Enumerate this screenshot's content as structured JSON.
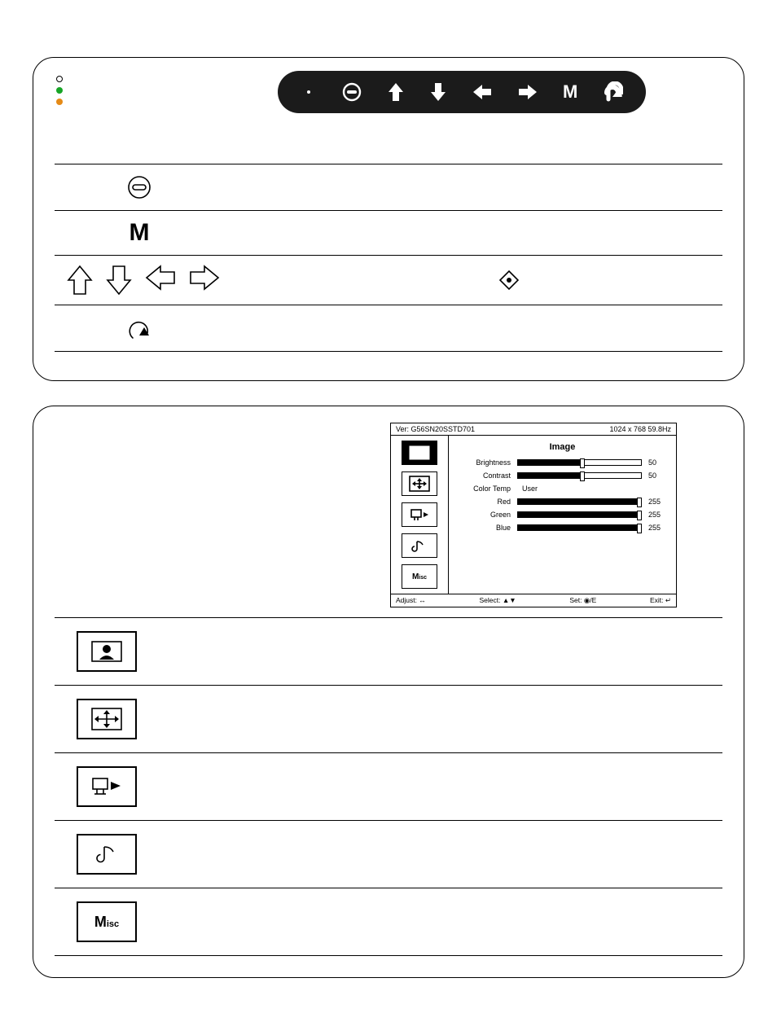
{
  "panel1": {
    "buttons": [
      "power",
      "menu-up",
      "menu-down",
      "menu-left",
      "menu-right",
      "menu-m",
      "return"
    ]
  },
  "osd": {
    "version_label": "Ver: G56SN20SSTD701",
    "mode_label": "1024 x 768  59.8Hz",
    "tabs": [
      "image",
      "position",
      "setup",
      "audio",
      "misc"
    ],
    "title": "Image",
    "brightness_label": "Brightness",
    "brightness_value": "50",
    "contrast_label": "Contrast",
    "contrast_value": "50",
    "colortemp_label": "Color Temp",
    "colortemp_value": "User",
    "red_label": "Red",
    "red_value": "255",
    "green_label": "Green",
    "green_value": "255",
    "blue_label": "Blue",
    "blue_value": "255",
    "footer": {
      "adjust": "Adjust: ↔",
      "select": "Select: ▲▼",
      "set": "Set: ◉/E",
      "exit": "Exit: ↵"
    },
    "misc_label": "Misc"
  },
  "chart_data": {
    "type": "table",
    "title": "Image",
    "categories": [
      "Brightness",
      "Contrast",
      "Red",
      "Green",
      "Blue"
    ],
    "values": [
      50,
      50,
      255,
      255,
      255
    ],
    "xlabel": "",
    "ylabel": "",
    "ylim": [
      0,
      255
    ]
  }
}
